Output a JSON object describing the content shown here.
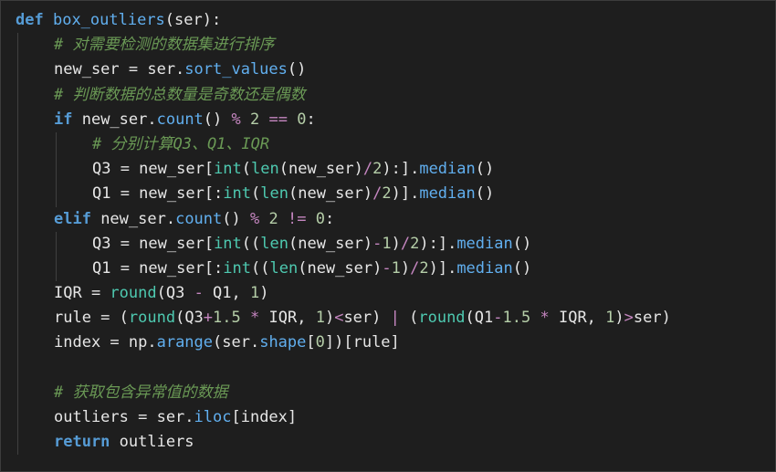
{
  "lines": [
    {
      "indent": 0,
      "tokens": [
        {
          "t": "def",
          "c": "def"
        },
        {
          "t": " ",
          "c": "plain"
        },
        {
          "t": "box_outliers",
          "c": "meth"
        },
        {
          "t": "(ser):",
          "c": "plain"
        }
      ]
    },
    {
      "indent": 1,
      "tokens": [
        {
          "t": "# 对需要检测的数据集进行排序",
          "c": "cmt"
        }
      ]
    },
    {
      "indent": 1,
      "tokens": [
        {
          "t": "new_ser = ser.",
          "c": "plain"
        },
        {
          "t": "sort_values",
          "c": "meth"
        },
        {
          "t": "()",
          "c": "plain"
        }
      ]
    },
    {
      "indent": 1,
      "tokens": [
        {
          "t": "# 判断数据的总数量是奇数还是偶数",
          "c": "cmt"
        }
      ]
    },
    {
      "indent": 1,
      "tokens": [
        {
          "t": "if",
          "c": "kw"
        },
        {
          "t": " new_ser.",
          "c": "plain"
        },
        {
          "t": "count",
          "c": "meth"
        },
        {
          "t": "() ",
          "c": "plain"
        },
        {
          "t": "%",
          "c": "op"
        },
        {
          "t": " ",
          "c": "plain"
        },
        {
          "t": "2",
          "c": "num"
        },
        {
          "t": " ",
          "c": "plain"
        },
        {
          "t": "==",
          "c": "op"
        },
        {
          "t": " ",
          "c": "plain"
        },
        {
          "t": "0",
          "c": "num"
        },
        {
          "t": ":",
          "c": "plain"
        }
      ]
    },
    {
      "indent": 2,
      "tokens": [
        {
          "t": "# 分别计算Q3、Q1、IQR",
          "c": "cmt"
        }
      ]
    },
    {
      "indent": 2,
      "tokens": [
        {
          "t": "Q3 = new_ser[",
          "c": "plain"
        },
        {
          "t": "int",
          "c": "bi"
        },
        {
          "t": "(",
          "c": "plain"
        },
        {
          "t": "len",
          "c": "bi"
        },
        {
          "t": "(new_ser)",
          "c": "plain"
        },
        {
          "t": "/",
          "c": "op"
        },
        {
          "t": "2",
          "c": "num"
        },
        {
          "t": "):].",
          "c": "plain"
        },
        {
          "t": "median",
          "c": "meth"
        },
        {
          "t": "()",
          "c": "plain"
        }
      ]
    },
    {
      "indent": 2,
      "tokens": [
        {
          "t": "Q1 = new_ser[:",
          "c": "plain"
        },
        {
          "t": "int",
          "c": "bi"
        },
        {
          "t": "(",
          "c": "plain"
        },
        {
          "t": "len",
          "c": "bi"
        },
        {
          "t": "(new_ser)",
          "c": "plain"
        },
        {
          "t": "/",
          "c": "op"
        },
        {
          "t": "2",
          "c": "num"
        },
        {
          "t": ")].",
          "c": "plain"
        },
        {
          "t": "median",
          "c": "meth"
        },
        {
          "t": "()",
          "c": "plain"
        }
      ]
    },
    {
      "indent": 1,
      "tokens": [
        {
          "t": "elif",
          "c": "kw"
        },
        {
          "t": " new_ser.",
          "c": "plain"
        },
        {
          "t": "count",
          "c": "meth"
        },
        {
          "t": "() ",
          "c": "plain"
        },
        {
          "t": "%",
          "c": "op"
        },
        {
          "t": " ",
          "c": "plain"
        },
        {
          "t": "2",
          "c": "num"
        },
        {
          "t": " ",
          "c": "plain"
        },
        {
          "t": "!=",
          "c": "op"
        },
        {
          "t": " ",
          "c": "plain"
        },
        {
          "t": "0",
          "c": "num"
        },
        {
          "t": ":",
          "c": "plain"
        }
      ]
    },
    {
      "indent": 2,
      "tokens": [
        {
          "t": "Q3 = new_ser[",
          "c": "plain"
        },
        {
          "t": "int",
          "c": "bi"
        },
        {
          "t": "((",
          "c": "plain"
        },
        {
          "t": "len",
          "c": "bi"
        },
        {
          "t": "(new_ser)",
          "c": "plain"
        },
        {
          "t": "-",
          "c": "op"
        },
        {
          "t": "1",
          "c": "num"
        },
        {
          "t": ")",
          "c": "plain"
        },
        {
          "t": "/",
          "c": "op"
        },
        {
          "t": "2",
          "c": "num"
        },
        {
          "t": "):].",
          "c": "plain"
        },
        {
          "t": "median",
          "c": "meth"
        },
        {
          "t": "()",
          "c": "plain"
        }
      ]
    },
    {
      "indent": 2,
      "tokens": [
        {
          "t": "Q1 = new_ser[:",
          "c": "plain"
        },
        {
          "t": "int",
          "c": "bi"
        },
        {
          "t": "((",
          "c": "plain"
        },
        {
          "t": "len",
          "c": "bi"
        },
        {
          "t": "(new_ser)",
          "c": "plain"
        },
        {
          "t": "-",
          "c": "op"
        },
        {
          "t": "1",
          "c": "num"
        },
        {
          "t": ")",
          "c": "plain"
        },
        {
          "t": "/",
          "c": "op"
        },
        {
          "t": "2",
          "c": "num"
        },
        {
          "t": ")].",
          "c": "plain"
        },
        {
          "t": "median",
          "c": "meth"
        },
        {
          "t": "()",
          "c": "plain"
        }
      ]
    },
    {
      "indent": 1,
      "tokens": [
        {
          "t": "IQR = ",
          "c": "plain"
        },
        {
          "t": "round",
          "c": "bi"
        },
        {
          "t": "(Q3 ",
          "c": "plain"
        },
        {
          "t": "-",
          "c": "op"
        },
        {
          "t": " Q1, ",
          "c": "plain"
        },
        {
          "t": "1",
          "c": "num"
        },
        {
          "t": ")",
          "c": "plain"
        }
      ]
    },
    {
      "indent": 1,
      "tokens": [
        {
          "t": "rule = (",
          "c": "plain"
        },
        {
          "t": "round",
          "c": "bi"
        },
        {
          "t": "(Q3",
          "c": "plain"
        },
        {
          "t": "+",
          "c": "op"
        },
        {
          "t": "1.5",
          "c": "num"
        },
        {
          "t": " ",
          "c": "plain"
        },
        {
          "t": "*",
          "c": "op"
        },
        {
          "t": " IQR, ",
          "c": "plain"
        },
        {
          "t": "1",
          "c": "num"
        },
        {
          "t": ")",
          "c": "plain"
        },
        {
          "t": "<",
          "c": "op"
        },
        {
          "t": "ser) ",
          "c": "plain"
        },
        {
          "t": "|",
          "c": "op"
        },
        {
          "t": " (",
          "c": "plain"
        },
        {
          "t": "round",
          "c": "bi"
        },
        {
          "t": "(Q1",
          "c": "plain"
        },
        {
          "t": "-",
          "c": "op"
        },
        {
          "t": "1.5",
          "c": "num"
        },
        {
          "t": " ",
          "c": "plain"
        },
        {
          "t": "*",
          "c": "op"
        },
        {
          "t": " IQR, ",
          "c": "plain"
        },
        {
          "t": "1",
          "c": "num"
        },
        {
          "t": ")",
          "c": "plain"
        },
        {
          "t": ">",
          "c": "op"
        },
        {
          "t": "ser)",
          "c": "plain"
        }
      ]
    },
    {
      "indent": 1,
      "tokens": [
        {
          "t": "index = np.",
          "c": "plain"
        },
        {
          "t": "arange",
          "c": "meth"
        },
        {
          "t": "(ser.",
          "c": "plain"
        },
        {
          "t": "shape",
          "c": "meth"
        },
        {
          "t": "[",
          "c": "plain"
        },
        {
          "t": "0",
          "c": "num"
        },
        {
          "t": "])[rule]",
          "c": "plain"
        }
      ]
    },
    {
      "indent": 1,
      "tokens": []
    },
    {
      "indent": 1,
      "tokens": [
        {
          "t": "# 获取包含异常值的数据",
          "c": "cmt"
        }
      ]
    },
    {
      "indent": 1,
      "tokens": [
        {
          "t": "outliers = ser.",
          "c": "plain"
        },
        {
          "t": "iloc",
          "c": "meth"
        },
        {
          "t": "[index]",
          "c": "plain"
        }
      ]
    },
    {
      "indent": 1,
      "tokens": [
        {
          "t": "return",
          "c": "kw"
        },
        {
          "t": " outliers",
          "c": "plain"
        }
      ]
    }
  ]
}
